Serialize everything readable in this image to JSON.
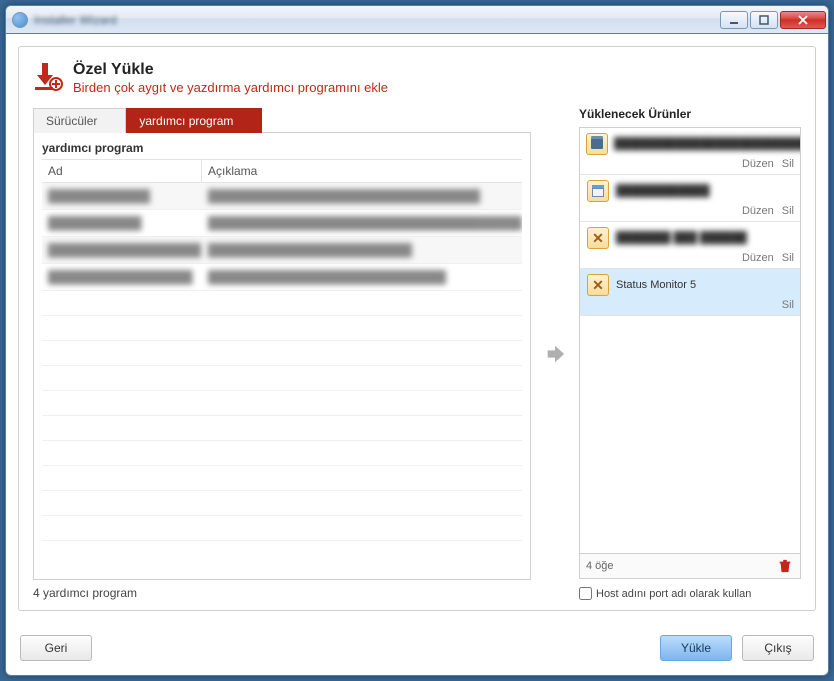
{
  "window": {
    "title": "Installer Wizard"
  },
  "header": {
    "title": "Özel Yükle",
    "subtitle": "Birden çok aygıt ve yazdırma yardımcı programını ekle"
  },
  "tabs": {
    "drivers": "Sürücüler",
    "utilities": "yardımcı program"
  },
  "list": {
    "title": "yardımcı program",
    "col_name": "Ad",
    "col_desc": "Açıklama",
    "rows": [
      {
        "name": "████████████",
        "desc": "████████████████████████████████"
      },
      {
        "name": "███████████",
        "desc": "██████████████████████████████████████████████"
      },
      {
        "name": "██████████████████",
        "desc": "████████████████████████"
      },
      {
        "name": "█████████████████",
        "desc": "████████████████████████████"
      }
    ],
    "footer": "4 yardımcı program"
  },
  "products": {
    "title": "Yüklenecek Ürünler",
    "edit_label": "Düzen",
    "delete_label": "Sil",
    "items": [
      {
        "name": "███████████████████████████",
        "icon": "printer",
        "edit": true,
        "delete": true,
        "blurred": true
      },
      {
        "name": "████████████",
        "icon": "window",
        "edit": true,
        "delete": true,
        "blurred": true
      },
      {
        "name": "███████ ███ ██████",
        "icon": "tools",
        "edit": true,
        "delete": true,
        "blurred": true
      },
      {
        "name": "Status Monitor 5",
        "icon": "tools",
        "edit": false,
        "delete": true,
        "blurred": false,
        "selected": true
      }
    ],
    "count": "4 öğe"
  },
  "host_checkbox": "Host adını port adı olarak kullan",
  "buttons": {
    "back": "Geri",
    "install": "Yükle",
    "exit": "Çıkış"
  }
}
